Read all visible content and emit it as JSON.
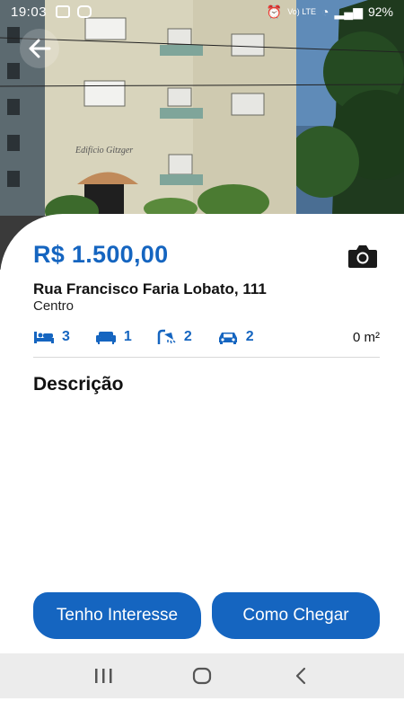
{
  "status_bar": {
    "time": "19:03",
    "network": "Vo) LTE",
    "battery": "92%",
    "icons": [
      "image-icon",
      "instagram-icon",
      "alarm-icon",
      "wifi-icon",
      "signal-icon",
      "battery-icon"
    ]
  },
  "hero": {
    "building_sign": "Edifício Gitzger"
  },
  "listing": {
    "price": "R$ 1.500,00",
    "address": "Rua Francisco Faria Lobato, 111",
    "neighborhood": "Centro",
    "bedrooms": "3",
    "living_rooms": "1",
    "bathrooms": "2",
    "parking": "2",
    "area": "0 m²"
  },
  "description": {
    "title": "Descrição"
  },
  "actions": {
    "interest_label": "Tenho Interesse",
    "directions_label": "Como Chegar"
  },
  "colors": {
    "accent": "#1565c0",
    "nav_background": "#ececec"
  },
  "nav": {
    "icons": [
      "recent-apps-icon",
      "home-icon",
      "back-nav-icon"
    ]
  }
}
